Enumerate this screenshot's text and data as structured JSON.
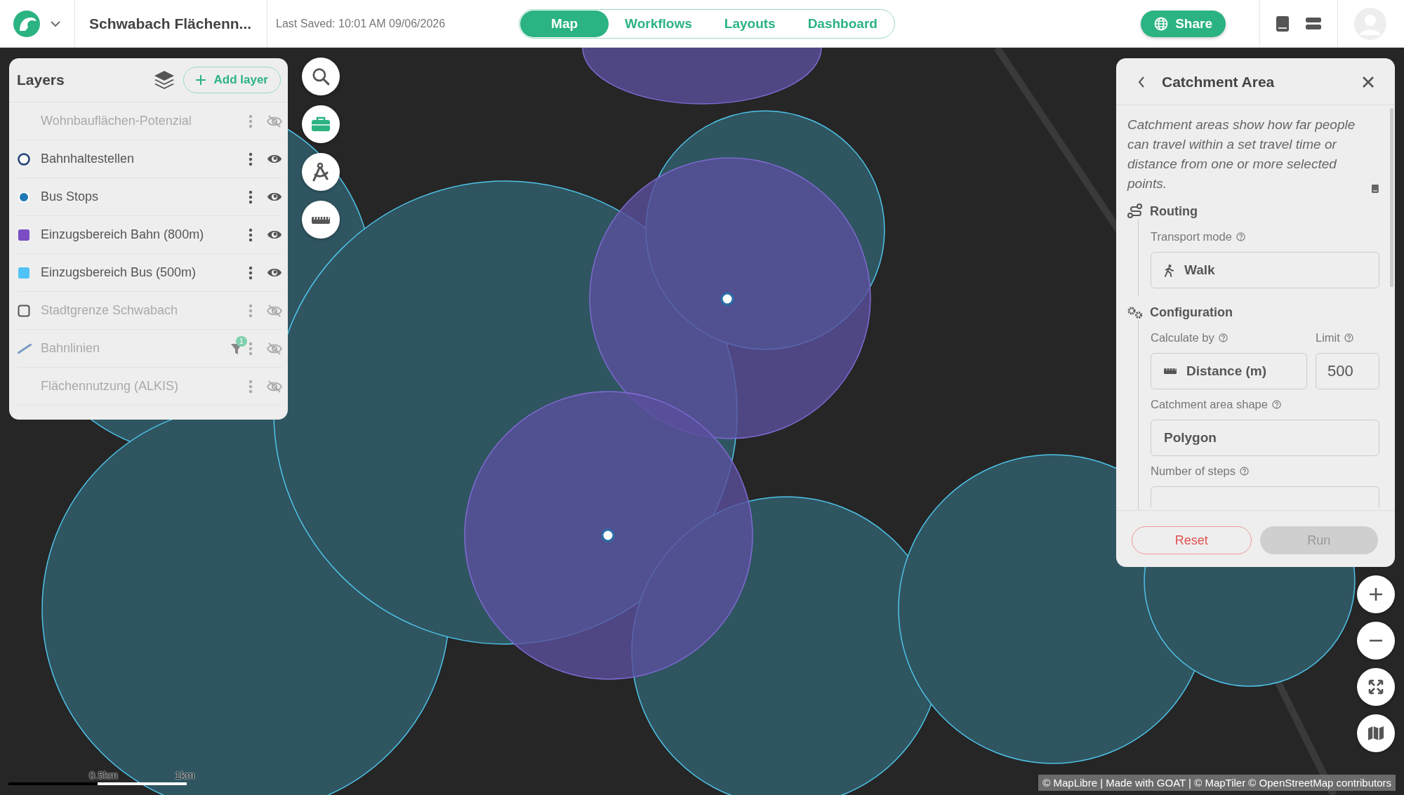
{
  "header": {
    "project_title": "Schwabach Flächenn...",
    "last_saved": "Last Saved: 10:01 AM 09/06/2026"
  },
  "tabs": [
    {
      "label": "Map",
      "selected": true
    },
    {
      "label": "Workflows",
      "selected": false
    },
    {
      "label": "Layouts",
      "selected": false
    },
    {
      "label": "Dashboard",
      "selected": false
    }
  ],
  "share_button": "Share",
  "layers_panel": {
    "title": "Layers",
    "add_button": "Add layer",
    "layers": [
      {
        "name": "Wohnbauflächen-Potenzial",
        "kind": "plain",
        "visible": false
      },
      {
        "name": "Bahnhaltestellen",
        "kind": "ring",
        "color": "#1d3f73",
        "visible": true
      },
      {
        "name": "Bus Stops",
        "kind": "dot",
        "color": "#1f78b4",
        "visible": true
      },
      {
        "name": "Einzugsbereich Bahn (800m)",
        "kind": "square",
        "color": "#7b4cc4",
        "visible": true
      },
      {
        "name": "Einzugsbereich Bus (500m)",
        "kind": "square",
        "color": "#4fc3f7",
        "visible": true
      },
      {
        "name": "Stadtgrenze Schwabach",
        "kind": "outline",
        "color": "#555555",
        "visible": false
      },
      {
        "name": "Bahnlinien",
        "kind": "line",
        "color": "#7a9cc4",
        "visible": false,
        "filter_count": "1"
      },
      {
        "name": "Flächennutzung (ALKIS)",
        "kind": "plain",
        "visible": false
      }
    ]
  },
  "tool_panel": {
    "title": "Catchment Area",
    "description": "Catchment areas show how far people can travel within a set travel time or distance from one or more selected points.",
    "routing": {
      "heading": "Routing",
      "transport_label": "Transport mode",
      "transport_value": "Walk"
    },
    "configuration": {
      "heading": "Configuration",
      "calculate_label": "Calculate by",
      "calculate_value": "Distance (m)",
      "limit_label": "Limit",
      "limit_value": "500",
      "shape_label": "Catchment area shape",
      "shape_value": "Polygon",
      "steps_label": "Number of steps"
    },
    "reset_button": "Reset",
    "run_button": {
      "label": "Run",
      "disabled": true
    }
  },
  "scale_bar": {
    "labels": [
      "0.5km",
      "1km"
    ]
  },
  "attribution": "© MapLibre | Made with GOAT | © MapTiler © OpenStreetMap contributors"
}
